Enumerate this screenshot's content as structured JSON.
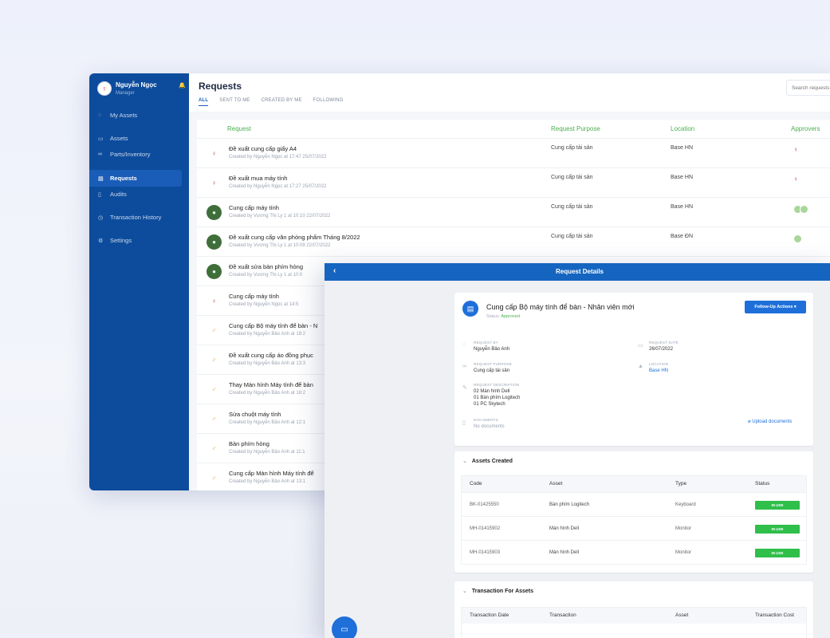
{
  "user": {
    "name": "Nguyễn Ngọc",
    "role": "Manager"
  },
  "sidebar": {
    "items": [
      {
        "label": "My Assets",
        "icon": "person-icon"
      },
      {
        "label": "Assets",
        "icon": "box-icon"
      },
      {
        "label": "Parts/Inventory",
        "icon": "link-icon"
      },
      {
        "label": "Requests",
        "icon": "document-icon",
        "active": true
      },
      {
        "label": "Audits",
        "icon": "clipboard-icon"
      },
      {
        "label": "Transaction History",
        "icon": "history-icon"
      },
      {
        "label": "Settings",
        "icon": "gear-icon"
      }
    ]
  },
  "page": {
    "title": "Requests",
    "tabs": [
      "ALL",
      "SENT TO ME",
      "CREATED BY ME",
      "FOLLOWING"
    ],
    "search_placeholder": "Search requests"
  },
  "table": {
    "headers": {
      "request": "Request",
      "purpose": "Request Purpose",
      "location": "Location",
      "approvers": "Approvers"
    },
    "rows": [
      {
        "title": "Đề xuất cung cấp giấy A4",
        "sub": "Created by Nguyễn Ngọc at 17:47 25/07/2022",
        "purpose": "Cung cấp tài sản",
        "location": "Base HN"
      },
      {
        "title": "Đề xuất mua máy tính",
        "sub": "Created by Nguyễn Ngọc at 17:27 25/07/2022",
        "purpose": "Cung cấp tài sản",
        "location": "Base HN"
      },
      {
        "title": "Cung cấp máy tính",
        "sub": "Created by Vương Thị Ly 1 at 10:10 22/07/2022",
        "purpose": "Cung cấp tài sản",
        "location": "Base HN"
      },
      {
        "title": "Đề xuất cung cấp văn phòng phẩm Tháng 8/2022",
        "sub": "Created by Vương Thị Ly 1 at 10:09 22/07/2022",
        "purpose": "Cung cấp tài sản",
        "location": "Base ĐN"
      },
      {
        "title": "Đề xuất sửa bàn phím hỏng",
        "sub": "Created by Vương Thị Ly 1 at 10:0",
        "purpose": "",
        "location": ""
      },
      {
        "title": "Cung cấp máy tính",
        "sub": "Created by Nguyễn Ngọc at 14:5",
        "purpose": "",
        "location": ""
      },
      {
        "title": "Cung cấp Bộ máy tính để bàn - N",
        "sub": "Created by Nguyễn Bảo Anh at 18:2",
        "purpose": "",
        "location": ""
      },
      {
        "title": "Đề xuất cung cấp áo đồng phục",
        "sub": "Created by Nguyễn Bảo Anh at 13:3",
        "purpose": "",
        "location": ""
      },
      {
        "title": "Thay Màn hình Máy tính để bàn",
        "sub": "Created by Nguyễn Bảo Anh at 18:2",
        "purpose": "",
        "location": ""
      },
      {
        "title": "Sửa chuột máy tính",
        "sub": "Created by Nguyễn Bảo Anh at 12:1",
        "purpose": "",
        "location": ""
      },
      {
        "title": "Bàn phím hỏng",
        "sub": "Created by Nguyễn Bảo Anh at 11:1",
        "purpose": "",
        "location": ""
      },
      {
        "title": "Cung cấp Màn hình Máy tính để",
        "sub": "Created by Nguyễn Bảo Anh at 13:1",
        "purpose": "",
        "location": ""
      }
    ]
  },
  "details": {
    "header": "Request Details",
    "title": "Cung cấp Bộ máy tính để bàn - Nhân viên mới",
    "status_label": "Status:",
    "status": "Approved",
    "follow_up": "Follow-Up Actions",
    "fields": {
      "request_by_label": "REQUEST BY",
      "request_by": "Nguyễn Bảo Anh",
      "request_date_label": "REQUEST DATE",
      "request_date": "26/07/2022",
      "purpose_label": "REQUEST PURPOSE",
      "purpose": "Cung cấp tài sản",
      "location_label": "LOCATION",
      "location": "Base HN",
      "description_label": "REQUEST DESCRIPTION",
      "description": [
        "02 Màn hình Dell",
        "01 Bàn phím Logitech",
        "01 PC Skytech"
      ],
      "documents_label": "DOCUMENTS",
      "documents": "No documents"
    },
    "upload": "Upload documents",
    "assets": {
      "title": "Assets Created",
      "headers": [
        "Code",
        "Asset",
        "Type",
        "Status"
      ],
      "rows": [
        {
          "code": "BK-01425550",
          "asset": "Bàn phím Logitech",
          "type": "Keyboard",
          "status": "IN USE"
        },
        {
          "code": "MH-01415902",
          "asset": "Màn hình Dell",
          "type": "Monitor",
          "status": "IN USE"
        },
        {
          "code": "MH-01415903",
          "asset": "Màn hình Dell",
          "type": "Monitor",
          "status": "IN USE"
        }
      ]
    },
    "transactions": {
      "title": "Transaction For Assets",
      "headers": [
        "Transaction Date",
        "Transaction",
        "Asset",
        "Transaction Cost"
      ]
    }
  },
  "colors": {
    "sidebar": "#0d4c9c",
    "accent": "#1e6fd9",
    "header_green": "#4caf50",
    "badge_green": "#2fbf4a"
  }
}
